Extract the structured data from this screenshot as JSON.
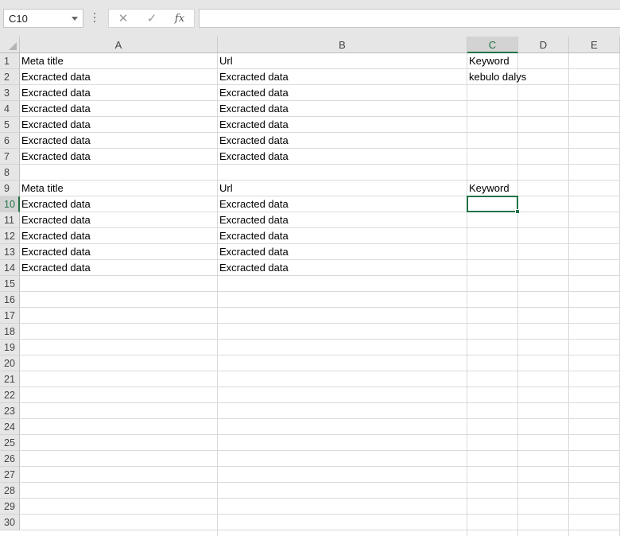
{
  "formula_bar": {
    "name_box": "C10",
    "cancel_symbol": "✕",
    "enter_symbol": "✓",
    "fx_symbol": "fx",
    "formula": ""
  },
  "columns": [
    "A",
    "B",
    "C",
    "D",
    "E"
  ],
  "selected_column": "C",
  "selected_row": 10,
  "rows": [
    1,
    2,
    3,
    4,
    5,
    6,
    7,
    8,
    9,
    10,
    11,
    12,
    13,
    14,
    15,
    16,
    17,
    18,
    19,
    20,
    21,
    22,
    23,
    24,
    25,
    26,
    27,
    28,
    29,
    30
  ],
  "cells": [
    {
      "ref": "A1",
      "value": "Meta title"
    },
    {
      "ref": "B1",
      "value": "Url"
    },
    {
      "ref": "C1",
      "value": "Keyword"
    },
    {
      "ref": "A2",
      "value": "Excracted data"
    },
    {
      "ref": "B2",
      "value": "Excracted data"
    },
    {
      "ref": "C2",
      "value": "kebulo dalys"
    },
    {
      "ref": "A3",
      "value": "Excracted data"
    },
    {
      "ref": "B3",
      "value": "Excracted data"
    },
    {
      "ref": "A4",
      "value": "Excracted data"
    },
    {
      "ref": "B4",
      "value": "Excracted data"
    },
    {
      "ref": "A5",
      "value": "Excracted data"
    },
    {
      "ref": "B5",
      "value": "Excracted data"
    },
    {
      "ref": "A6",
      "value": "Excracted data"
    },
    {
      "ref": "B6",
      "value": "Excracted data"
    },
    {
      "ref": "A7",
      "value": "Excracted data"
    },
    {
      "ref": "B7",
      "value": "Excracted data"
    },
    {
      "ref": "A9",
      "value": "Meta title"
    },
    {
      "ref": "B9",
      "value": "Url"
    },
    {
      "ref": "C9",
      "value": "Keyword"
    },
    {
      "ref": "A10",
      "value": "Excracted data"
    },
    {
      "ref": "B10",
      "value": "Excracted data"
    },
    {
      "ref": "A11",
      "value": "Excracted data"
    },
    {
      "ref": "B11",
      "value": "Excracted data"
    },
    {
      "ref": "A12",
      "value": "Excracted data"
    },
    {
      "ref": "B12",
      "value": "Excracted data"
    },
    {
      "ref": "A13",
      "value": "Excracted data"
    },
    {
      "ref": "B13",
      "value": "Excracted data"
    },
    {
      "ref": "A14",
      "value": "Excracted data"
    },
    {
      "ref": "B14",
      "value": "Excracted data"
    }
  ],
  "colors": {
    "accent": "#217346",
    "header_bg": "#e6e6e6",
    "gridline": "#dadada"
  },
  "icons": {
    "cancel": "close-icon",
    "enter": "check-icon",
    "function": "fx-icon",
    "name_box_dropdown": "chevron-down-icon"
  }
}
